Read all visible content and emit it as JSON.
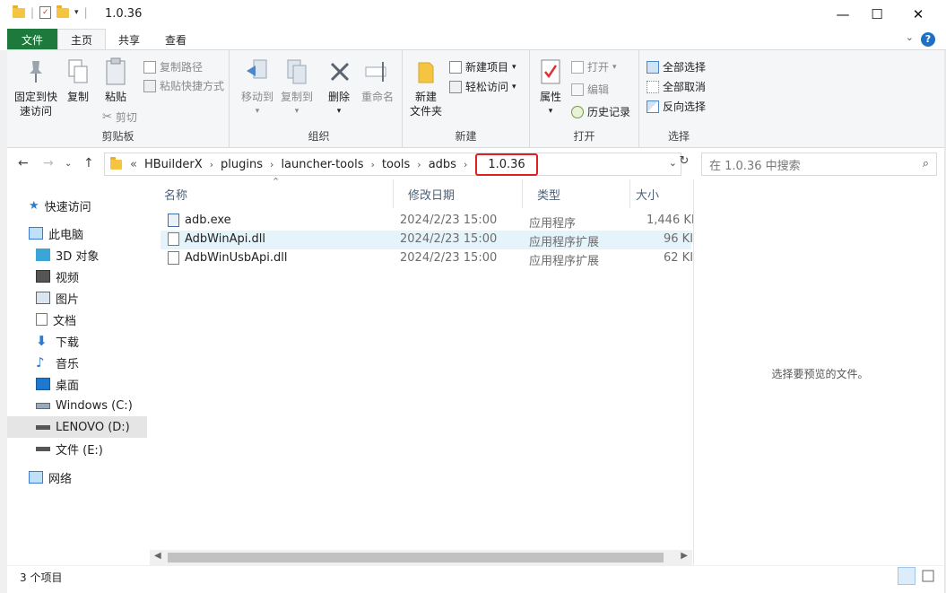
{
  "window": {
    "title": "1.0.36",
    "minimize": "—",
    "maximize": "☐",
    "close": "✕"
  },
  "ribbon_tabs": [
    "文件",
    "主页",
    "共享",
    "查看"
  ],
  "ribbon": {
    "clipboard": {
      "pin": "固定到快\n速访问",
      "pin_l1": "固定到快",
      "pin_l2": "速访问",
      "copy": "复制",
      "paste": "粘贴",
      "copy_path": "复制路径",
      "paste_shortcut": "粘贴快捷方式",
      "cut": "剪切",
      "label": "剪贴板"
    },
    "organize": {
      "move_to": "移动到",
      "copy_to": "复制到",
      "delete": "删除",
      "rename": "重命名",
      "label": "组织"
    },
    "new": {
      "new_folder_l1": "新建",
      "new_folder_l2": "文件夹",
      "new_item": "新建项目",
      "easy_access": "轻松访问",
      "label": "新建"
    },
    "open": {
      "properties": "属性",
      "open": "打开",
      "edit": "编辑",
      "history": "历史记录",
      "label": "打开"
    },
    "select": {
      "select_all": "全部选择",
      "select_none": "全部取消",
      "invert": "反向选择",
      "label": "选择"
    }
  },
  "address": {
    "overflow": "«",
    "crumbs": [
      "HBuilderX",
      "plugins",
      "launcher-tools",
      "tools",
      "adbs"
    ],
    "current": "1.0.36"
  },
  "search": {
    "placeholder": "在 1.0.36 中搜索"
  },
  "nav_pane": {
    "quick_access": "快速访问",
    "this_pc": "此电脑",
    "items": [
      "3D 对象",
      "视频",
      "图片",
      "文档",
      "下载",
      "音乐",
      "桌面",
      "Windows (C:)",
      "LENOVO (D:)",
      "文件 (E:)"
    ],
    "network": "网络"
  },
  "columns": {
    "name": "名称",
    "date": "修改日期",
    "type": "类型",
    "size": "大小"
  },
  "files": [
    {
      "name": "adb.exe",
      "date": "2024/2/23 15:00",
      "type": "应用程序",
      "size": "1,446 KI"
    },
    {
      "name": "AdbWinApi.dll",
      "date": "2024/2/23 15:00",
      "type": "应用程序扩展",
      "size": "96 KI"
    },
    {
      "name": "AdbWinUsbApi.dll",
      "date": "2024/2/23 15:00",
      "type": "应用程序扩展",
      "size": "62 KI"
    }
  ],
  "preview": {
    "message": "选择要预览的文件。"
  },
  "status": {
    "count": "3 个项目"
  },
  "colors": {
    "file_tab": "#1e7a3c",
    "highlight_box": "#e02020",
    "hover_row": "#e5f3fb",
    "selected_nav": "#e5e5e5"
  }
}
